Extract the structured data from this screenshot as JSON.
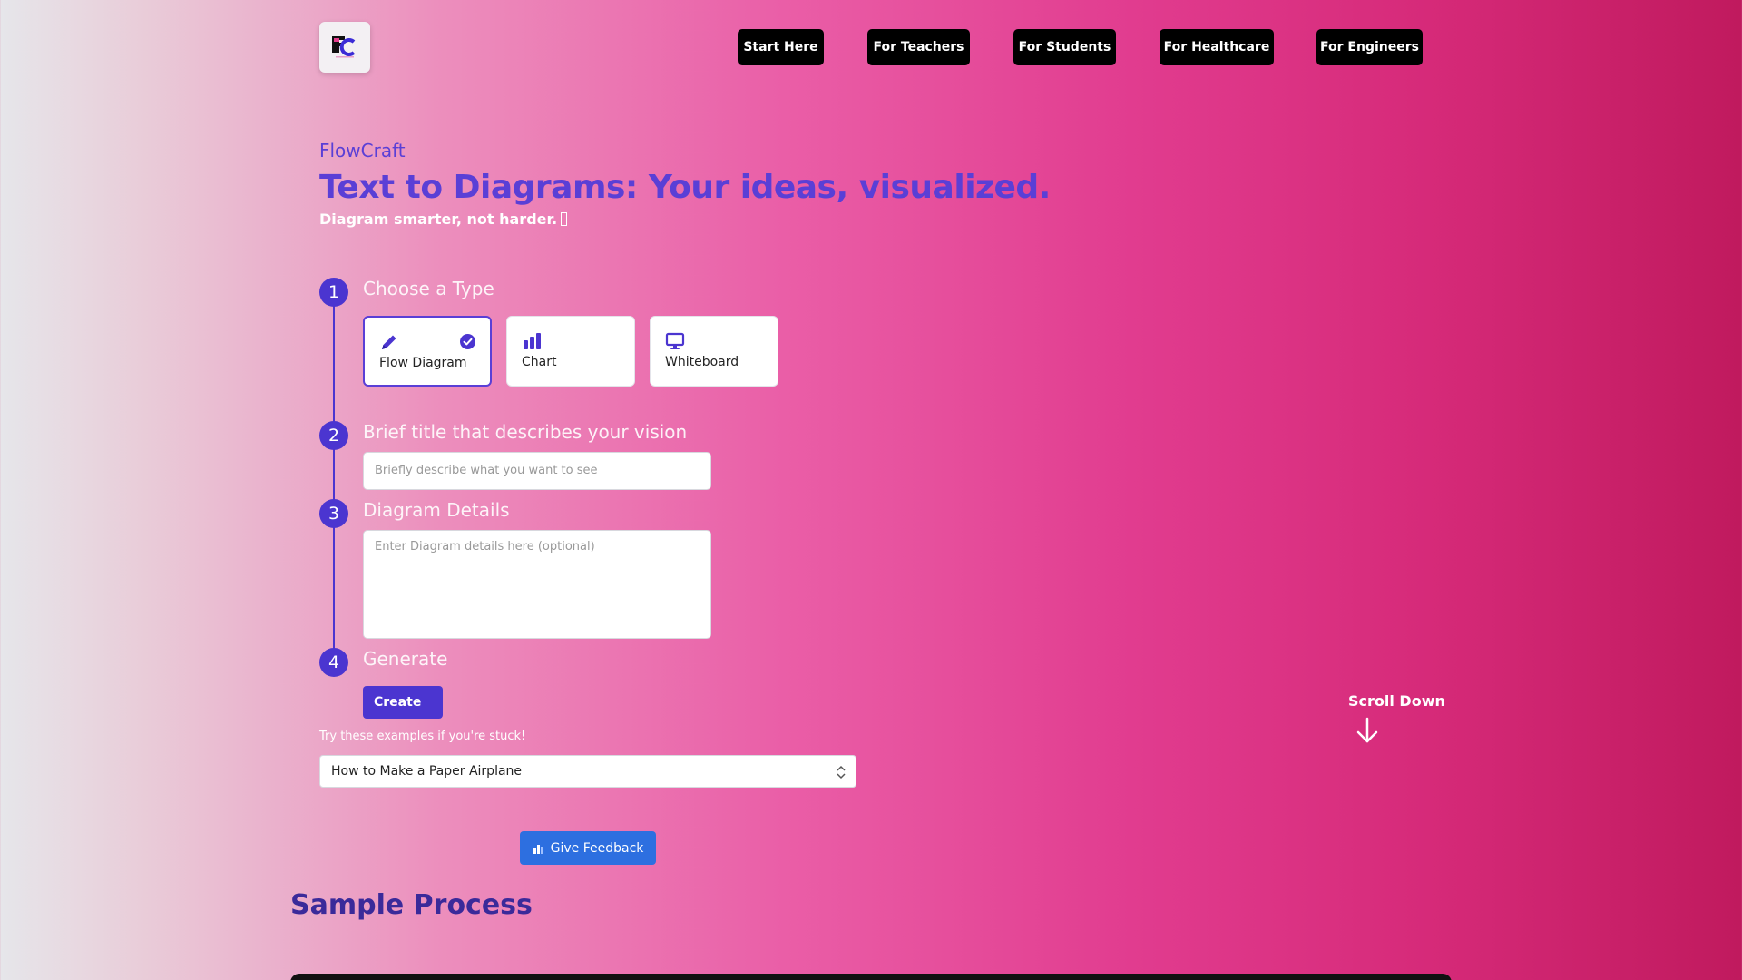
{
  "nav": {
    "items": [
      {
        "label": "Start Here"
      },
      {
        "label": "For Teachers"
      },
      {
        "label": "For Students"
      },
      {
        "label": "For Healthcare"
      },
      {
        "label": "For Engineers"
      }
    ]
  },
  "hero": {
    "brand": "FlowCraft",
    "headline": "Text to Diagrams: Your ideas, visualized.",
    "tagline": "Diagram smarter, not harder."
  },
  "steps": [
    {
      "number": "1",
      "title": "Choose a Type"
    },
    {
      "number": "2",
      "title": "Brief title that describes your vision"
    },
    {
      "number": "3",
      "title": "Diagram Details"
    },
    {
      "number": "4",
      "title": "Generate"
    }
  ],
  "types": [
    {
      "label": "Flow Diagram",
      "icon": "pencil-icon",
      "selected": true
    },
    {
      "label": "Chart",
      "icon": "bar-chart-icon",
      "selected": false
    },
    {
      "label": "Whiteboard",
      "icon": "monitor-icon",
      "selected": false
    }
  ],
  "form": {
    "title_placeholder": "Briefly describe what you want to see",
    "details_placeholder": "Enter Diagram details here (optional)",
    "create_label": "Create"
  },
  "examples": {
    "hint": "Try these examples if you're stuck!",
    "selected": "How to Make a Paper Airplane"
  },
  "feedback": {
    "label": "Give Feedback"
  },
  "scroll": {
    "label": "Scroll Down"
  },
  "sample": {
    "title": "Sample Process"
  },
  "colors": {
    "accent": "#4b35d0",
    "brand_text": "#5a3fd6",
    "feedback": "#2d6fe0",
    "nav_bg": "#000000"
  }
}
